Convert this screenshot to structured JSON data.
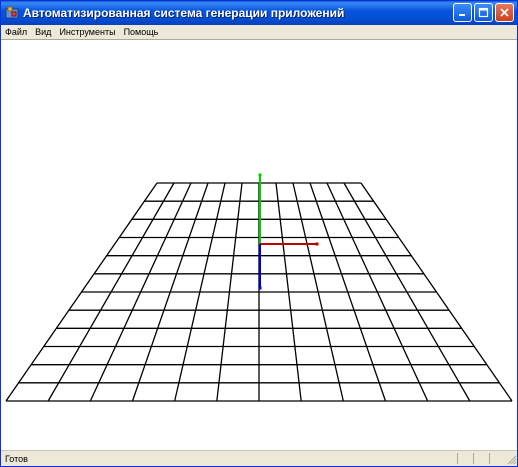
{
  "window": {
    "title": "Автоматизированная система генерации приложений",
    "icon": "app-icon",
    "buttons": [
      "minimize-icon",
      "maximize-icon",
      "close-icon"
    ]
  },
  "menu": {
    "items": [
      {
        "label": "Файл"
      },
      {
        "label": "Вид"
      },
      {
        "label": "Инструменты"
      },
      {
        "label": "Помощь"
      }
    ]
  },
  "scene": {
    "grid_color": "#000000",
    "axis_colors": {
      "x": "#c00000",
      "y": "#00cc00",
      "z": "#0000cc"
    },
    "grid_cells": 12
  },
  "status": {
    "text": "Готов"
  }
}
